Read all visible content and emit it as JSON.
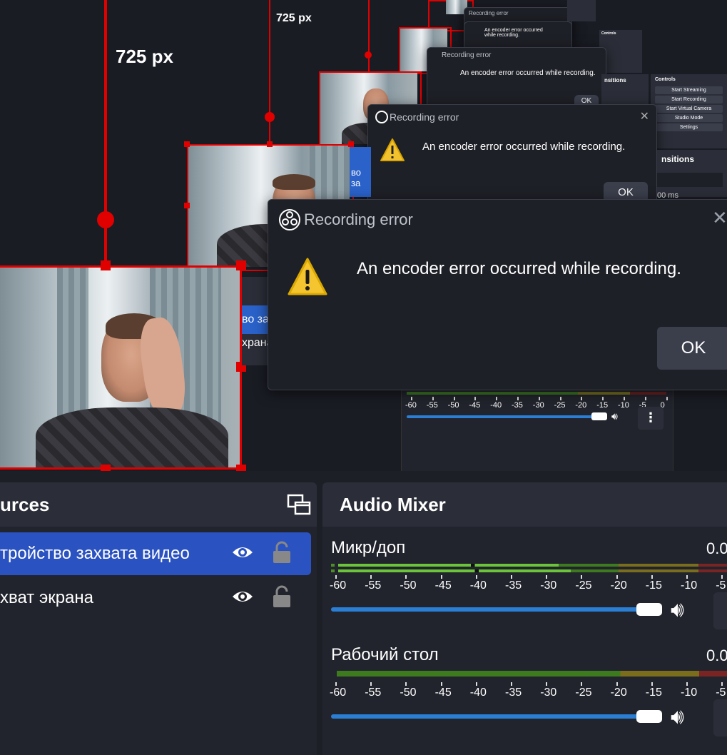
{
  "preview": {
    "size_label_large": "725 px",
    "size_label_small": "725 px",
    "bg_source_labels": [
      "во за",
      "храна"
    ]
  },
  "dialogs": {
    "title": "Recording error",
    "message": "An encoder error occurred while recording.",
    "ok_label": "OK"
  },
  "mini_controls": {
    "heading": "Controls",
    "transitions_heading": "nsitions",
    "transition_duration": "00 ms",
    "buttons": [
      "Start Streaming",
      "Start Recording",
      "Start Virtual Camera",
      "Studio Mode",
      "Settings"
    ]
  },
  "mixer_mini": {
    "ticks": [
      "-60",
      "-55",
      "-50",
      "-45",
      "-40",
      "-35",
      "-30",
      "-25",
      "-20",
      "-15",
      "-10",
      "-5",
      "0"
    ]
  },
  "sources": {
    "title": "urces",
    "items": [
      {
        "label": "тройство захвата видео",
        "selected": true
      },
      {
        "label": "хват экрана",
        "selected": false
      }
    ]
  },
  "audio_mixer": {
    "title": "Audio Mixer",
    "channels": [
      {
        "name": "Микр/доп",
        "level": "0.0"
      },
      {
        "name": "Рабочий стол",
        "level": "0.0"
      }
    ],
    "ticks": [
      "-60",
      "-55",
      "-50",
      "-45",
      "-40",
      "-35",
      "-30",
      "-25",
      "-20",
      "-15",
      "-10",
      "-5"
    ],
    "volume_fraction": 0.93
  },
  "colors": {
    "accent_blue": "#2a62c9",
    "selection_red": "#e00000",
    "meter_green": "#5fb832",
    "meter_yellow": "#a39a2a",
    "meter_red": "#8a2a2a"
  }
}
